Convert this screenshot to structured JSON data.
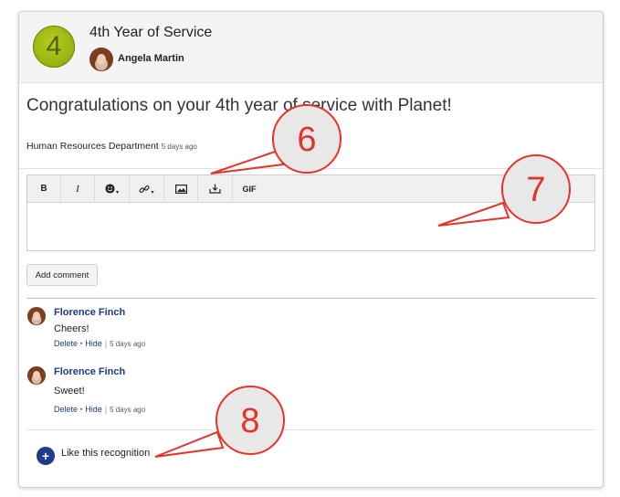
{
  "recognition": {
    "badge_number": "4",
    "title": "4th Year of Service",
    "giver_name": "Angela Martin",
    "message": "Congratulations on your 4th year of service with Planet!",
    "department": "Human Resources Department",
    "time_ago": "5 days ago"
  },
  "editor": {
    "toolbar": {
      "bold": "B",
      "italic": "I",
      "gif": "GIF"
    },
    "text_value": ""
  },
  "add_comment_label": "Add comment",
  "comments": [
    {
      "author": "Florence Finch",
      "text": "Cheers!",
      "delete": "Delete",
      "separator": "•",
      "hide": "Hide",
      "time_ago": "5 days ago"
    },
    {
      "author": "Florence Finch",
      "text": "Sweet!",
      "delete": "Delete",
      "separator": "•",
      "hide": "Hide",
      "time_ago": "5 days ago"
    }
  ],
  "like_label": "Like this recognition",
  "callouts": {
    "six": "6",
    "seven": "7",
    "eight": "8"
  },
  "colors": {
    "accent": "#1f3b8a",
    "badge": "#98b10f",
    "callout_stroke": "#e5332a"
  }
}
